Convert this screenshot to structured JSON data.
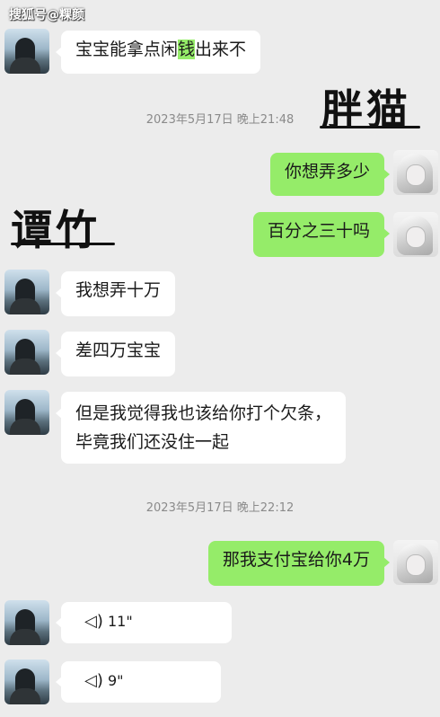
{
  "watermark": "搜狐号@粿颜",
  "annotations": {
    "right_name": "胖猫",
    "left_name": "谭竹"
  },
  "messages": [
    {
      "side": "left",
      "parts": [
        "宝宝能拿点闲",
        "钱",
        "出来不"
      ]
    },
    {
      "type": "timestamp",
      "text": "2023年5月17日 晚上21:48"
    },
    {
      "side": "right",
      "text": "你想弄多少"
    },
    {
      "side": "right",
      "text": "百分之三十吗"
    },
    {
      "side": "left",
      "text": "我想弄十万"
    },
    {
      "side": "left",
      "text": "差四万宝宝"
    },
    {
      "side": "left",
      "lines": [
        "但是我觉得我也该给你打个欠条，",
        "毕竟我们还没住一起"
      ]
    },
    {
      "type": "timestamp",
      "text": "2023年5月17日 晚上22:12"
    },
    {
      "side": "right",
      "text": "那我支付宝给你4万"
    },
    {
      "side": "left",
      "type": "voice",
      "duration": "11\""
    },
    {
      "side": "left",
      "type": "voice",
      "duration": "9\""
    }
  ],
  "colors": {
    "background": "#ececec",
    "incoming_bubble": "#ffffff",
    "outgoing_bubble": "#95ec69",
    "timestamp_text": "#8a8a8a"
  },
  "icons": {
    "voice": "voice-wave-icon",
    "left_avatar": "avatar-icon",
    "right_avatar": "avatar-icon"
  }
}
